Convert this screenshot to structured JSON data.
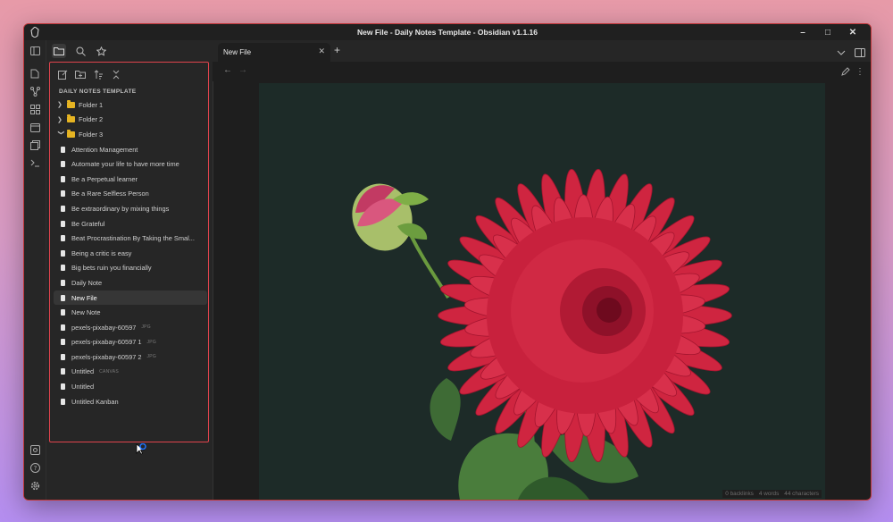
{
  "window": {
    "title": "New File - Daily Notes Template - Obsidian v1.1.16"
  },
  "explorer": {
    "vault_name": "DAILY NOTES TEMPLATE",
    "folders": [
      {
        "name": "Folder 1",
        "expanded": false
      },
      {
        "name": "Folder 2",
        "expanded": false
      },
      {
        "name": "Folder 3",
        "expanded": true
      }
    ],
    "files": [
      {
        "name": "Attention Management",
        "ext": ""
      },
      {
        "name": "Automate your life to have more time",
        "ext": ""
      },
      {
        "name": "Be a Perpetual learner",
        "ext": ""
      },
      {
        "name": "Be a Rare Selfless Person",
        "ext": ""
      },
      {
        "name": "Be extraordinary by mixing things",
        "ext": ""
      },
      {
        "name": "Be Grateful",
        "ext": ""
      },
      {
        "name": "Beat Procrastination By Taking the Smal...",
        "ext": ""
      },
      {
        "name": "Being a critic is easy",
        "ext": ""
      },
      {
        "name": "Big bets ruin you financially",
        "ext": ""
      },
      {
        "name": "Daily Note",
        "ext": ""
      },
      {
        "name": "New File",
        "ext": "",
        "active": true
      },
      {
        "name": "New Note",
        "ext": ""
      },
      {
        "name": "pexels-pixabay-60597",
        "ext": "JPG"
      },
      {
        "name": "pexels-pixabay-60597 1",
        "ext": "JPG"
      },
      {
        "name": "pexels-pixabay-60597 2",
        "ext": "JPG"
      },
      {
        "name": "Untitled",
        "ext": "CANVAS"
      },
      {
        "name": "Untitled",
        "ext": ""
      },
      {
        "name": "Untitled Kanban",
        "ext": ""
      }
    ]
  },
  "tabs": [
    {
      "label": "New File",
      "active": true
    }
  ],
  "statusbar": {
    "backlinks": "0 backlinks",
    "words": "4 words",
    "characters": "44 characters"
  },
  "icons": {
    "ribbon": [
      "sidebar-toggle-icon",
      "open-quick-switcher-icon",
      "graph-view-icon",
      "canvas-icon",
      "daily-note-icon",
      "templates-icon",
      "command-palette-icon"
    ],
    "sidebar_tabs": [
      "folder-icon",
      "search-icon",
      "star-icon"
    ],
    "nav_actions": [
      "new-note-icon",
      "new-folder-icon",
      "sort-icon",
      "collapse-all-icon"
    ],
    "bottom": [
      "vault-switcher-icon",
      "help-icon",
      "settings-icon"
    ]
  },
  "colors": {
    "accent_border": "#e0434d",
    "folder": "#e6b422",
    "background": "#1e1e1e",
    "image_bg": "#1d2b28",
    "flower": "#d42a44"
  }
}
